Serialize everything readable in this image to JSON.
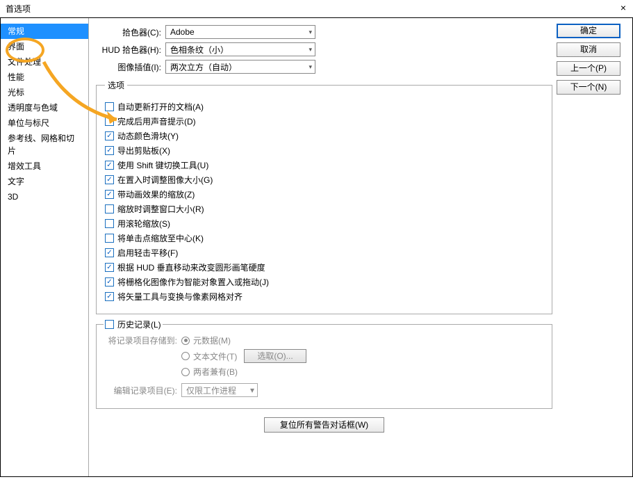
{
  "window": {
    "title": "首选项",
    "close": "×"
  },
  "sidebar": {
    "items": [
      "常规",
      "界面",
      "文件处理",
      "性能",
      "光标",
      "透明度与色域",
      "单位与标尺",
      "参考线、网格和切片",
      "增效工具",
      "文字",
      "3D"
    ]
  },
  "buttons": {
    "ok": "确定",
    "cancel": "取消",
    "prev": "上一个(P)",
    "next": "下一个(N)"
  },
  "pickers": {
    "color_picker_label": "拾色器(C):",
    "color_picker_value": "Adobe",
    "hud_label": "HUD 拾色器(H):",
    "hud_value": "色相条纹（小）",
    "interp_label": "图像插值(I):",
    "interp_value": "两次立方（自动）"
  },
  "options_group": {
    "legend": "选项",
    "items": [
      {
        "label": "自动更新打开的文档(A)",
        "checked": false
      },
      {
        "label": "完成后用声音提示(D)",
        "checked": false
      },
      {
        "label": "动态颜色滑块(Y)",
        "checked": true
      },
      {
        "label": "导出剪贴板(X)",
        "checked": true
      },
      {
        "label": "使用 Shift 键切换工具(U)",
        "checked": true
      },
      {
        "label": "在置入时调整图像大小(G)",
        "checked": true
      },
      {
        "label": "带动画效果的缩放(Z)",
        "checked": true
      },
      {
        "label": "缩放时调整窗口大小(R)",
        "checked": false
      },
      {
        "label": "用滚轮缩放(S)",
        "checked": false
      },
      {
        "label": "将单击点缩放至中心(K)",
        "checked": false
      },
      {
        "label": "启用轻击平移(F)",
        "checked": true
      },
      {
        "label": "根据 HUD 垂直移动来改变圆形画笔硬度",
        "checked": true
      },
      {
        "label": "将栅格化图像作为智能对象置入或拖动(J)",
        "checked": true
      },
      {
        "label": "将矢量工具与变换与像素网格对齐",
        "checked": true
      }
    ]
  },
  "history": {
    "title": "历史记录(L)",
    "save_to_label": "将记录项目存储到:",
    "radios": [
      "元数据(M)",
      "文本文件(T)",
      "两者兼有(B)"
    ],
    "choose_btn": "选取(O)...",
    "edit_label": "编辑记录项目(E):",
    "edit_value": "仅限工作进程"
  },
  "reset_btn": "复位所有警告对话框(W)"
}
